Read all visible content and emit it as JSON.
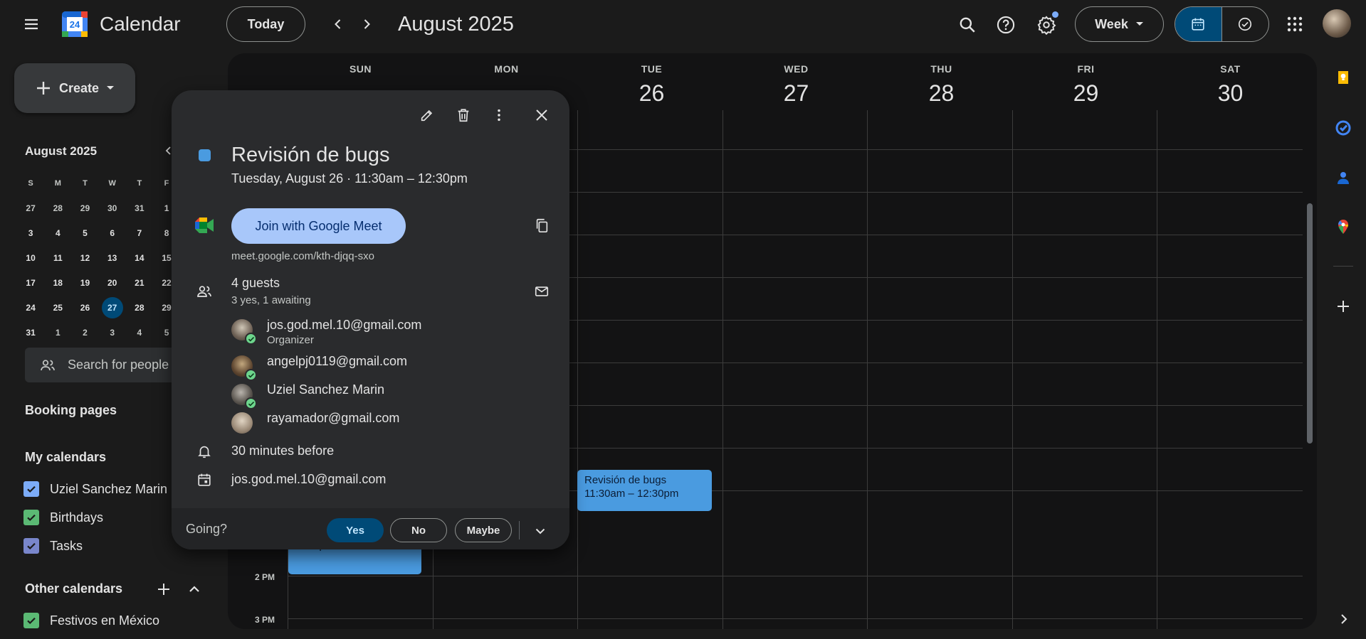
{
  "header": {
    "app_title": "Calendar",
    "logo_day": "24",
    "today_label": "Today",
    "period_label": "August 2025",
    "view_label": "Week",
    "icons": [
      "menu-icon",
      "calendar-logo-icon",
      "chevron-left-icon",
      "chevron-right-icon",
      "search-icon",
      "help-icon",
      "settings-icon",
      "arrow-dropdown-icon",
      "calendar-view-icon",
      "tasks-view-icon",
      "apps-grid-icon"
    ]
  },
  "sidebar": {
    "create_label": "Create",
    "mini_calendar": {
      "title": "August 2025",
      "weekdays": [
        "S",
        "M",
        "T",
        "W",
        "T",
        "F"
      ],
      "weeks": [
        [
          "27",
          "28",
          "29",
          "30",
          "31",
          "1"
        ],
        [
          "3",
          "4",
          "5",
          "6",
          "7",
          "8"
        ],
        [
          "10",
          "11",
          "12",
          "13",
          "14",
          "15"
        ],
        [
          "17",
          "18",
          "19",
          "20",
          "21",
          "22"
        ],
        [
          "24",
          "25",
          "26",
          "27",
          "28",
          "29"
        ],
        [
          "31",
          "1",
          "2",
          "3",
          "4",
          "5"
        ]
      ],
      "today": "27"
    },
    "search_people_placeholder": "Search for people",
    "booking_pages": "Booking pages",
    "my_calendars_title": "My calendars",
    "my_calendars": [
      {
        "label": "Uziel Sanchez Marin",
        "color": "#7cacf8"
      },
      {
        "label": "Birthdays",
        "color": "#5bb974"
      },
      {
        "label": "Tasks",
        "color": "#7986cb"
      }
    ],
    "other_calendars_title": "Other calendars",
    "other_calendars": [
      {
        "label": "Festivos en México",
        "color": "#5bb974"
      }
    ]
  },
  "week": {
    "days": [
      {
        "name": "SUN",
        "num": ""
      },
      {
        "name": "MON",
        "num": ""
      },
      {
        "name": "TUE",
        "num": "26"
      },
      {
        "name": "WED",
        "num": "27"
      },
      {
        "name": "THU",
        "num": "28"
      },
      {
        "name": "FRI",
        "num": "29"
      },
      {
        "name": "SAT",
        "num": "30"
      }
    ],
    "time_labels": [
      "2 PM",
      "3 PM"
    ],
    "events": [
      {
        "title": "Revisión de bugs",
        "time": "11:30am – 12:30pm",
        "day": "TUE"
      },
      {
        "title": "",
        "time": "1 – 2pm",
        "day": "SUN"
      }
    ]
  },
  "popup": {
    "title": "Revisión de bugs",
    "when": "Tuesday, August 26  ·  11:30am – 12:30pm",
    "color": "#4a9be0",
    "meet_label": "Join with Google Meet",
    "meet_link": "meet.google.com/kth-djqq-sxo",
    "guests_count": "4 guests",
    "guests_summary": "3 yes, 1 awaiting",
    "guests": [
      {
        "name": "jos.god.mel.10@gmail.com",
        "role": "Organizer",
        "accepted": true
      },
      {
        "name": "angelpj0119@gmail.com",
        "role": "",
        "accepted": true
      },
      {
        "name": "Uziel Sanchez Marin",
        "role": "",
        "accepted": true
      },
      {
        "name": "rayamador@gmail.com",
        "role": "",
        "accepted": false
      }
    ],
    "reminder": "30 minutes before",
    "calendar_owner": "jos.god.mel.10@gmail.com",
    "going_label": "Going?",
    "rsvp": {
      "yes": "Yes",
      "no": "No",
      "maybe": "Maybe"
    }
  }
}
